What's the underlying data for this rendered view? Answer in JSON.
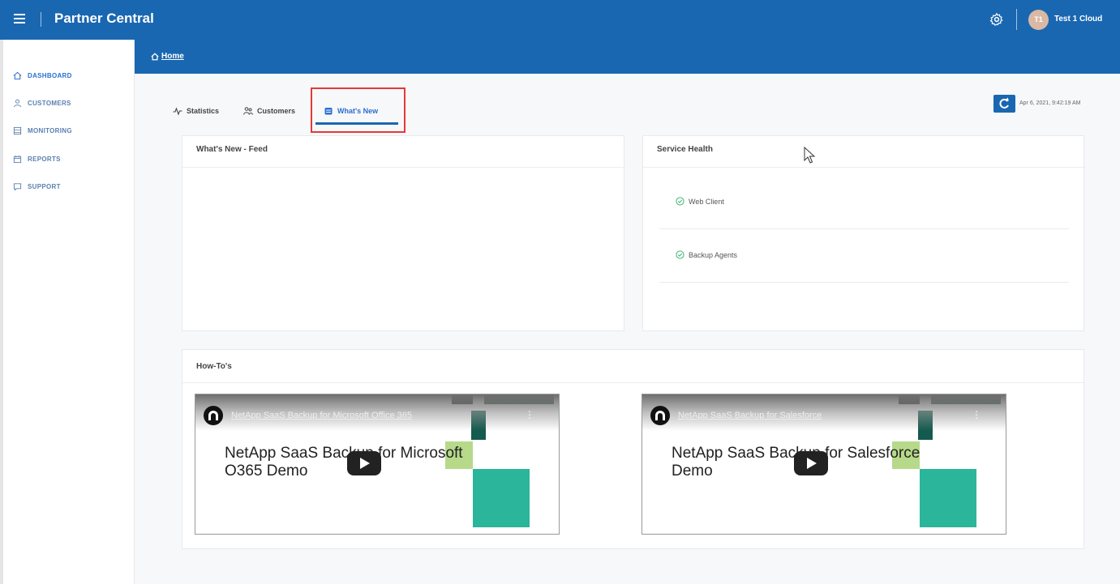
{
  "header": {
    "app_title": "Partner Central",
    "menu_icon": "hamburger-menu-icon",
    "settings_icon": "gear-icon",
    "avatar_initials": "T1",
    "user_name": "Test 1 Cloud",
    "brand_color": "#1a67b1"
  },
  "sidebar": {
    "items": [
      {
        "label": "DASHBOARD",
        "icon": "home-icon",
        "active": true
      },
      {
        "label": "CUSTOMERS",
        "icon": "person-icon",
        "active": false
      },
      {
        "label": "MONITORING",
        "icon": "monitor-icon",
        "active": false
      },
      {
        "label": "REPORTS",
        "icon": "calendar-icon",
        "active": false
      },
      {
        "label": "SUPPORT",
        "icon": "chat-icon",
        "active": false
      }
    ]
  },
  "breadcrumb": {
    "label": "Home",
    "icon": "home-icon"
  },
  "tabs": [
    {
      "label": "Statistics",
      "icon": "activity-icon",
      "active": false
    },
    {
      "label": "Customers",
      "icon": "users-icon",
      "active": false
    },
    {
      "label": "What's New",
      "icon": "news-icon",
      "active": true
    }
  ],
  "refresh": {
    "icon": "refresh-icon",
    "timestamp": "Apr 6, 2021, 9:42:19 AM"
  },
  "whats_new_feed": {
    "title": "What's New - Feed"
  },
  "service_health": {
    "title": "Service Health",
    "items": [
      {
        "label": "Web Client",
        "status": "ok",
        "status_color": "#3fb573"
      },
      {
        "label": "Backup Agents",
        "status": "ok",
        "status_color": "#3fb573"
      }
    ]
  },
  "howtos": {
    "title": "How-To's",
    "videos": [
      {
        "header": "NetApp SaaS Backup for Microsoft Office 365",
        "heading": "NetApp SaaS Backup for Microsoft O365 Demo"
      },
      {
        "header": "NetApp SaaS Backup for Salesforce",
        "heading": "NetApp SaaS Backup for Salesforce Demo"
      }
    ]
  }
}
